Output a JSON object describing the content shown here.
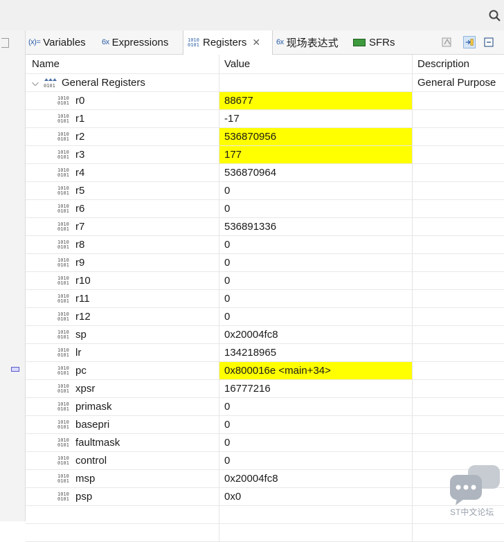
{
  "tabs": [
    {
      "icon": "(x)=",
      "label": "Variables",
      "name": "tab-variables"
    },
    {
      "icon": "6x",
      "label": "Expressions",
      "name": "tab-expressions"
    },
    {
      "icon": "1010",
      "label": "Registers",
      "name": "tab-registers",
      "active": true,
      "close": "✕"
    },
    {
      "icon": "6x",
      "label": "现场表达式",
      "name": "tab-live-expressions"
    },
    {
      "icon": "sfr",
      "label": "SFRs",
      "name": "tab-sfrs"
    }
  ],
  "table": {
    "headers": {
      "name": "Name",
      "value": "Value",
      "description": "Description"
    },
    "group": {
      "label": "General Registers",
      "description": "General Purpose"
    },
    "rows": [
      {
        "name": "r0",
        "value": "88677",
        "highlight": true
      },
      {
        "name": "r1",
        "value": "-17",
        "highlight": false
      },
      {
        "name": "r2",
        "value": "536870956",
        "highlight": true
      },
      {
        "name": "r3",
        "value": "177",
        "highlight": true
      },
      {
        "name": "r4",
        "value": "536870964",
        "highlight": false
      },
      {
        "name": "r5",
        "value": "0",
        "highlight": false
      },
      {
        "name": "r6",
        "value": "0",
        "highlight": false
      },
      {
        "name": "r7",
        "value": "536891336",
        "highlight": false
      },
      {
        "name": "r8",
        "value": "0",
        "highlight": false
      },
      {
        "name": "r9",
        "value": "0",
        "highlight": false
      },
      {
        "name": "r10",
        "value": "0",
        "highlight": false
      },
      {
        "name": "r11",
        "value": "0",
        "highlight": false
      },
      {
        "name": "r12",
        "value": "0",
        "highlight": false
      },
      {
        "name": "sp",
        "value": "0x20004fc8",
        "highlight": false
      },
      {
        "name": "lr",
        "value": "134218965",
        "highlight": false
      },
      {
        "name": "pc",
        "value": "0x800016e <main+34>",
        "highlight": true
      },
      {
        "name": "xpsr",
        "value": "16777216",
        "highlight": false
      },
      {
        "name": "primask",
        "value": "0",
        "highlight": false
      },
      {
        "name": "basepri",
        "value": "0",
        "highlight": false
      },
      {
        "name": "faultmask",
        "value": "0",
        "highlight": false
      },
      {
        "name": "control",
        "value": "0",
        "highlight": false
      },
      {
        "name": "msp",
        "value": "0x20004fc8",
        "highlight": false
      },
      {
        "name": "psp",
        "value": "0x0",
        "highlight": false
      }
    ]
  },
  "binary_icon": {
    "top": "1010",
    "bottom": "0101"
  },
  "watermark": {
    "text": "ST中文论坛"
  },
  "colors": {
    "highlight": "#ffff00",
    "accent": "#2e5fa8"
  }
}
